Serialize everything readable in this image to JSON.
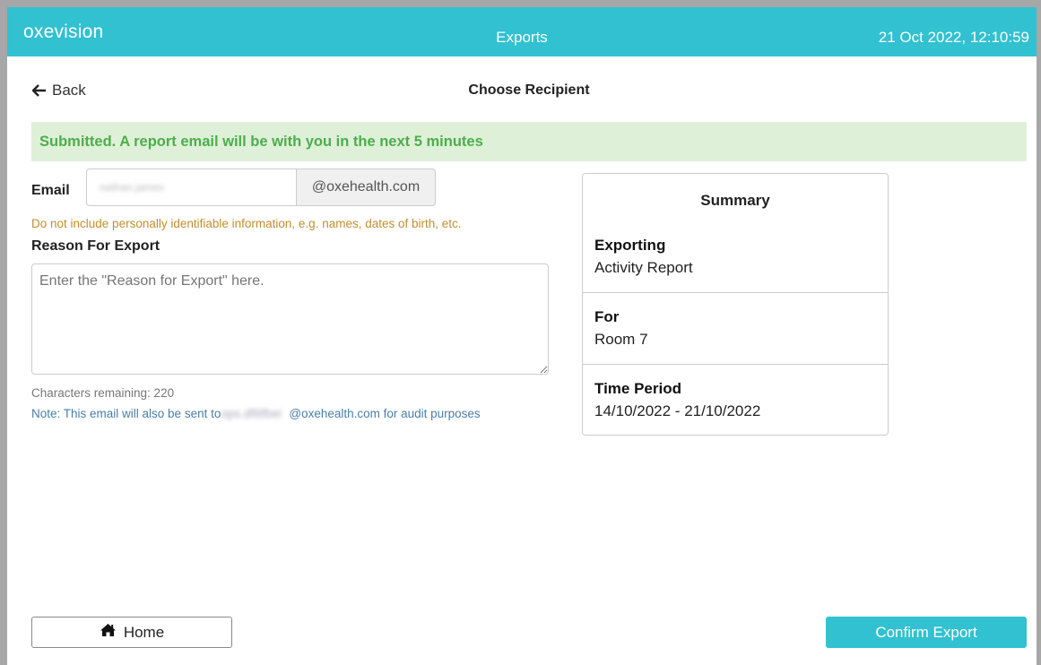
{
  "header": {
    "logo": "oxevision",
    "title": "Exports",
    "datetime": "21 Oct 2022, 12:10:59",
    "accent_color": "#31c1d1"
  },
  "nav": {
    "back_label": "Back",
    "page_title": "Choose Recipient"
  },
  "alert": {
    "message": "Submitted. A report email will be with you in the next 5 minutes"
  },
  "form": {
    "email_label": "Email",
    "email_value": "nathan.james",
    "email_domain": "@oxehealth.com",
    "pii_warning": "Do not include personally identifiable information, e.g. names, dates of birth, etc.",
    "reason_label": "Reason For Export",
    "reason_placeholder": "Enter the \"Reason for Export\" here.",
    "chars_remaining": "Characters remaining: 220",
    "note_prefix": "Note: This email will also be sent to",
    "note_blurred": "ops.dfilifbei",
    "note_suffix": "@oxehealth.com for audit purposes"
  },
  "summary": {
    "title": "Summary",
    "sections": [
      {
        "label": "Exporting",
        "value": "Activity Report"
      },
      {
        "label": "For",
        "value": "Room 7"
      },
      {
        "label": "Time Period",
        "value": "14/10/2022 - 21/10/2022"
      }
    ]
  },
  "footer": {
    "home_label": "Home",
    "confirm_label": "Confirm Export"
  }
}
